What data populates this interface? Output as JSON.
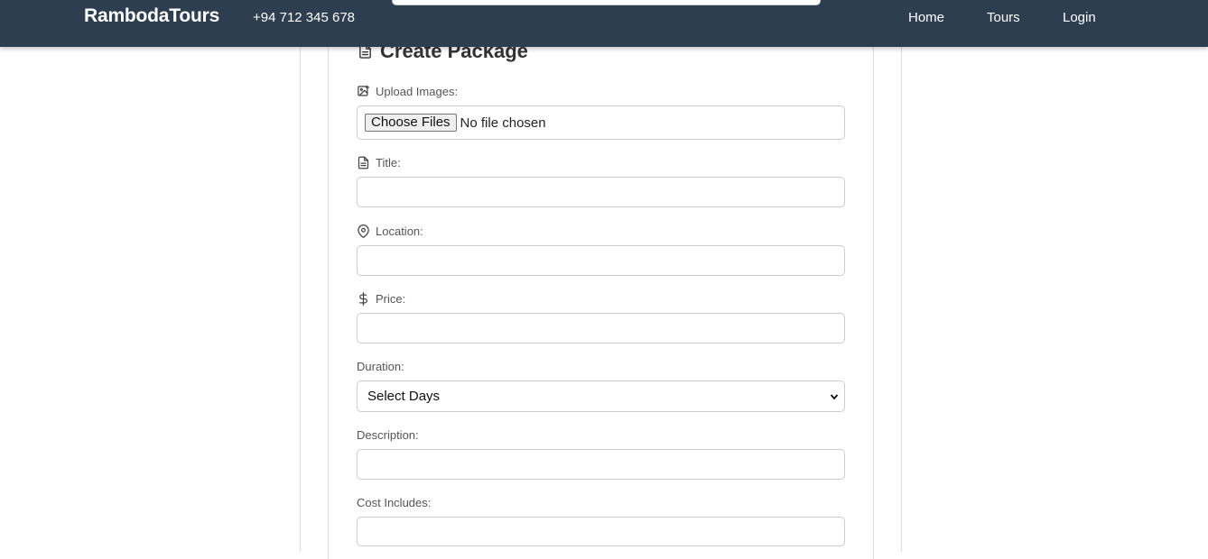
{
  "header": {
    "brand": "RambodaTours",
    "phone": "+94 712 345 678",
    "nav": [
      {
        "label": "Home"
      },
      {
        "label": "Tours"
      },
      {
        "label": "Login"
      }
    ]
  },
  "form": {
    "title": "Create Package",
    "upload_label": "Upload Images:",
    "upload_button": "Choose Files",
    "upload_status": "No file chosen",
    "title_label": "Title:",
    "title_value": "",
    "location_label": "Location:",
    "location_value": "",
    "price_label": "Price:",
    "price_value": "",
    "duration_label": "Duration:",
    "duration_selected": "Select Days",
    "description_label": "Description:",
    "description_value": "",
    "cost_includes_label": "Cost Includes:",
    "cost_includes_value": ""
  },
  "colors": {
    "navbar": "#2c3e50",
    "text": "#333333"
  }
}
